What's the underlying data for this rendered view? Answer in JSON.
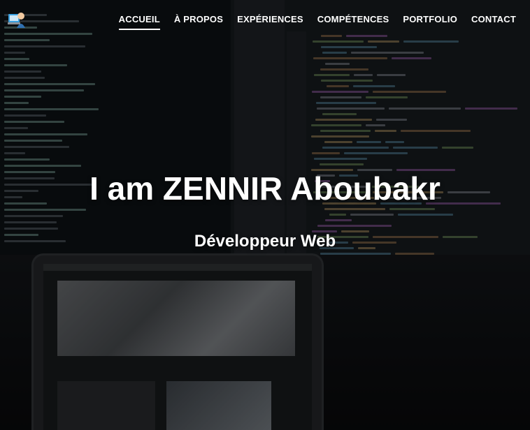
{
  "nav": {
    "items": [
      {
        "label": "ACCUEIL",
        "active": true
      },
      {
        "label": "À PROPOS",
        "active": false
      },
      {
        "label": "EXPÉRIENCES",
        "active": false
      },
      {
        "label": "COMPÉTENCES",
        "active": false
      },
      {
        "label": "PORTFOLIO",
        "active": false
      },
      {
        "label": "CONTACT",
        "active": false
      }
    ]
  },
  "hero": {
    "title": "I am ZENNIR Aboubakr",
    "subtitle": "Développeur Web"
  },
  "logo": {
    "icon": "developer-avatar-icon"
  },
  "colors": {
    "nav_text": "#ffffff",
    "overlay": "#000000"
  }
}
